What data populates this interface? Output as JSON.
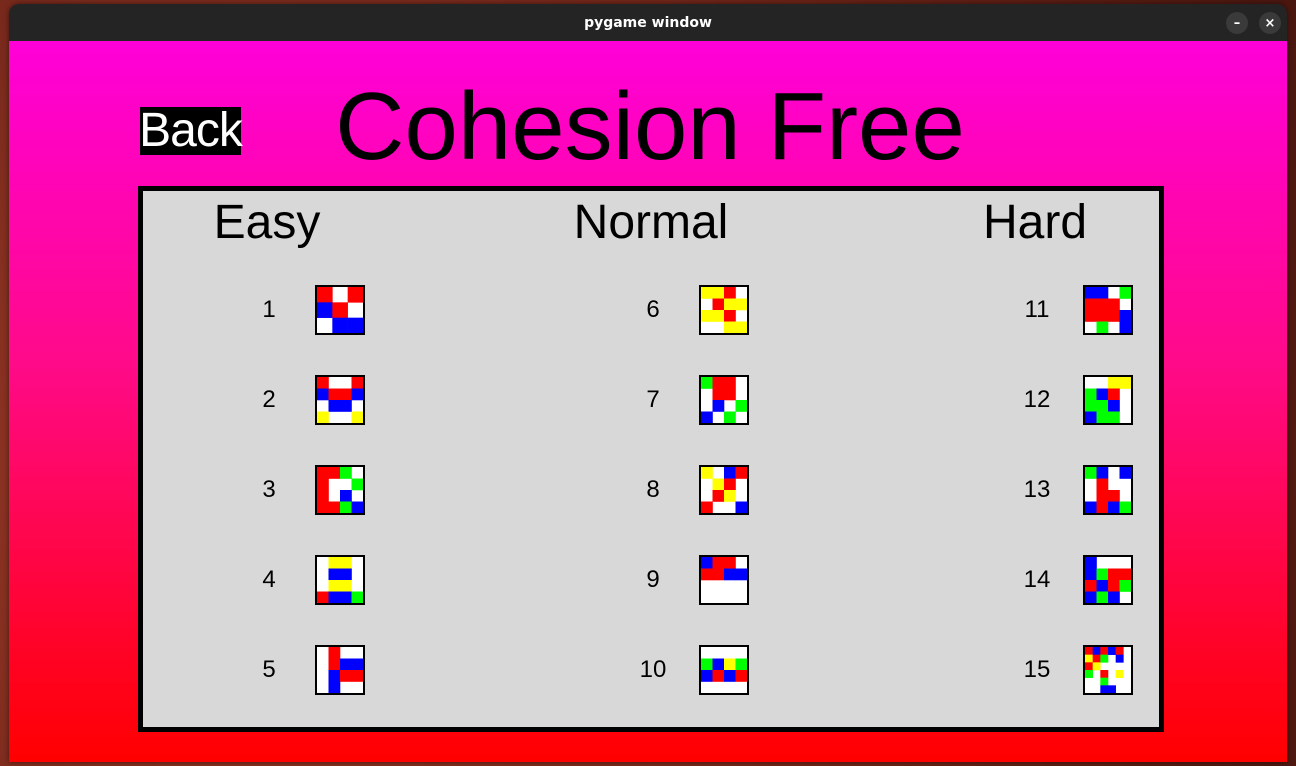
{
  "window": {
    "title": "pygame window",
    "minimize_label": "–",
    "close_label": "×"
  },
  "menu": {
    "back_label": "Back",
    "title": "Cohesion Free"
  },
  "colors": {
    "R": "#ff0000",
    "B": "#0000ff",
    "G": "#00ff00",
    "Y": "#ffff00",
    "W": "#ffffff"
  },
  "columns": [
    {
      "heading": "Easy",
      "levels": [
        {
          "number": "1",
          "grid": [
            "RWR",
            "BRW",
            "WBB"
          ]
        },
        {
          "number": "2",
          "grid": [
            "RWWR",
            "BRRB",
            "WBBW",
            "YWWY"
          ]
        },
        {
          "number": "3",
          "grid": [
            "RRGW",
            "RWWG",
            "RWBW",
            "RRGB"
          ]
        },
        {
          "number": "4",
          "grid": [
            "WYYW",
            "WBBW",
            "WYYW",
            "RBBG"
          ]
        },
        {
          "number": "5",
          "grid": [
            "WRWW",
            "WRBB",
            "WBRR",
            "WBWW"
          ]
        }
      ]
    },
    {
      "heading": "Normal",
      "levels": [
        {
          "number": "6",
          "grid": [
            "YYRW",
            "WRYY",
            "YYRW",
            "WWYY"
          ]
        },
        {
          "number": "7",
          "grid": [
            "GRRW",
            "WRRW",
            "WBWG",
            "BWGW"
          ]
        },
        {
          "number": "8",
          "grid": [
            "YWBR",
            "WYRW",
            "WRYW",
            "RWWB"
          ]
        },
        {
          "number": "9",
          "grid": [
            "BRRW",
            "RRBB",
            "WWWW",
            "WWWW"
          ]
        },
        {
          "number": "10",
          "grid": [
            "WWWW",
            "GBYG",
            "BRBR",
            "WWWW"
          ]
        }
      ]
    },
    {
      "heading": "Hard",
      "levels": [
        {
          "number": "11",
          "grid": [
            "BBWG",
            "RRRW",
            "RRRB",
            "WGWB"
          ]
        },
        {
          "number": "12",
          "grid": [
            "WWYY",
            "GBRW",
            "GGBW",
            "BGGW"
          ]
        },
        {
          "number": "13",
          "grid": [
            "GBWB",
            "WRWW",
            "WRRW",
            "BRBG"
          ]
        },
        {
          "number": "14",
          "grid": [
            "BWWW",
            "BGRR",
            "RBRG",
            "BGBW"
          ]
        },
        {
          "number": "15",
          "grid": [
            "RBRBRW",
            "YRGWBW",
            "RYWWWW",
            "GWRWYW",
            "WWGWWW",
            "WWBBWW"
          ]
        }
      ]
    }
  ]
}
